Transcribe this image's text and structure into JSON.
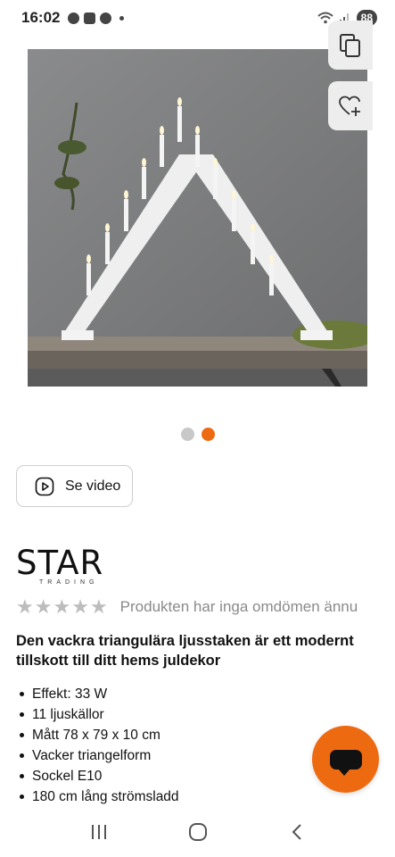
{
  "status_bar": {
    "time": "16:02",
    "battery": "88",
    "icons": [
      "chat-bubble-icon",
      "image-icon",
      "navigation-icon",
      "wifi-icon",
      "signal-icon"
    ]
  },
  "product_image": {
    "carousel_total": 2,
    "carousel_active": 2
  },
  "side_actions": {
    "copy_icon": "copy-icon",
    "wishlist_icon": "heart-plus-icon"
  },
  "video_button": {
    "label": "Se video",
    "icon": "play-icon"
  },
  "brand": {
    "name": "STAR",
    "sub": "TRADING"
  },
  "rating": {
    "stars": 5,
    "filled": 0,
    "text": "Produkten har inga omdömen ännu"
  },
  "description": "Den vackra triangulära ljusstaken är ett modernt tillskott till ditt hems juldekor",
  "features": [
    "Effekt: 33 W",
    "11 ljuskällor",
    "Mått 78 x 79 x 10 cm",
    "Vacker triangelform",
    "Sockel E10",
    "180 cm lång strömsladd"
  ],
  "chat": {
    "icon": "chat-icon"
  },
  "nav": {
    "recent_icon": "recent-apps-icon",
    "home_icon": "home-icon",
    "back_icon": "back-icon"
  },
  "colors": {
    "accent": "#ee6a11",
    "dot_inactive": "#c8c8c8",
    "star_empty": "#bdbdbd"
  }
}
